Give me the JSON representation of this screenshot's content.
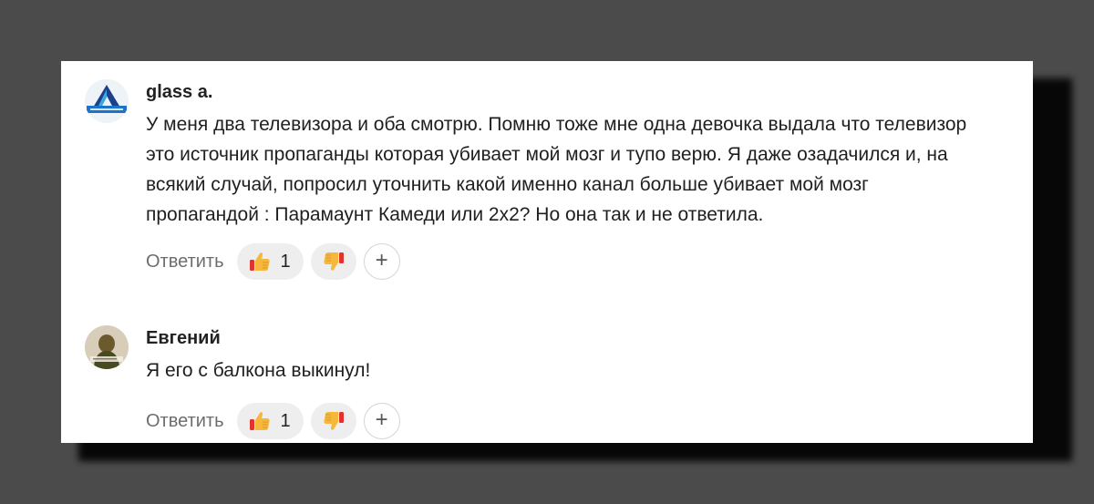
{
  "comments": [
    {
      "author": "glass a.",
      "avatar_icon": "arkadiya-logo-icon",
      "text": "У меня два телевизора и оба смотрю. Помню тоже мне одна девочка выдала что телевизор это источник пропаганды которая убивает мой мозг и тупо верю. Я даже озадачился и, на всякий случай, попросил уточнить какой именно канал больше убивает мой мозг пропагандой : Парамаунт Камеди или 2х2? Но она так и не ответила.",
      "reply_label": "Ответить",
      "like_count": "1",
      "like_icon": "thumbs-up-emoji-icon",
      "dislike_icon": "thumbs-down-emoji-icon",
      "add_reaction": "+"
    },
    {
      "author": "Евгений",
      "avatar_icon": "user-photo-avatar",
      "text": "Я его с балкона выкинул!",
      "reply_label": "Ответить",
      "like_count": "1",
      "like_icon": "thumbs-up-emoji-icon",
      "dislike_icon": "thumbs-down-emoji-icon",
      "add_reaction": "+"
    }
  ],
  "colors": {
    "background": "#4b4b4b",
    "card": "#ffffff",
    "pill": "#eeeeee",
    "emoji_yellow": "#f6b83a",
    "emoji_red": "#e2322d"
  }
}
